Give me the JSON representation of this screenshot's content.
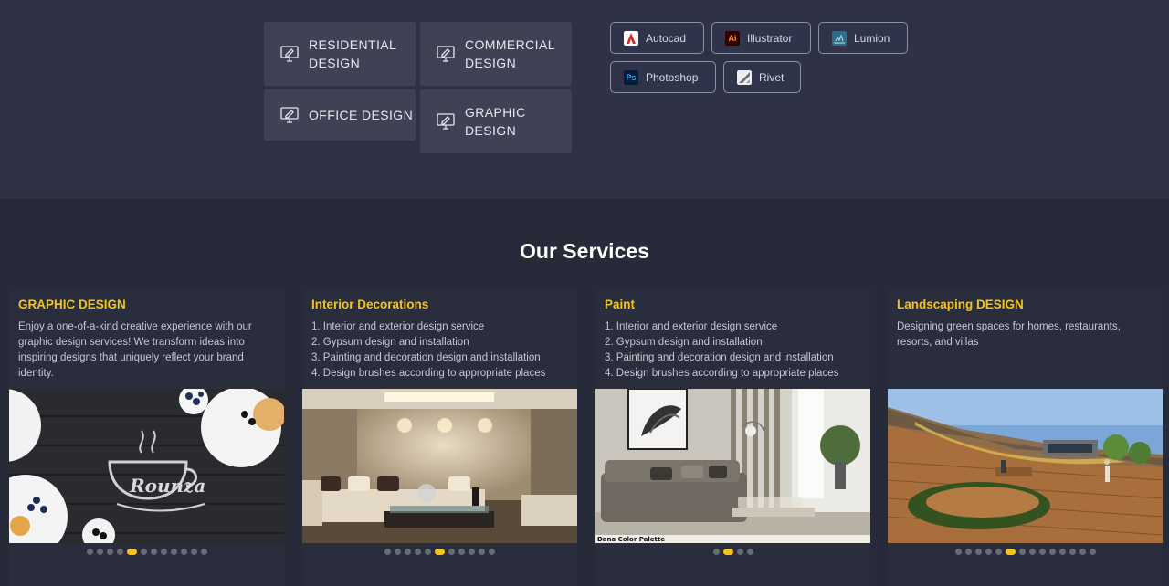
{
  "categories": [
    {
      "label": "RESIDENTIAL\nDESIGN",
      "icon": "monitor-design-icon"
    },
    {
      "label": "COMMERCIAL\nDESIGN",
      "icon": "monitor-design-icon"
    },
    {
      "label": "OFFICE DESIGN",
      "icon": "monitor-design-icon"
    },
    {
      "label": "GRAPHIC\nDESIGN",
      "icon": "monitor-design-icon"
    }
  ],
  "software": [
    {
      "name": "Autocad",
      "icon": "autocad-logo-icon",
      "color": "#d8262d"
    },
    {
      "name": "Illustrator",
      "icon": "illustrator-logo-icon",
      "badge": "Ai",
      "color": "#ff9a00"
    },
    {
      "name": "Lumion",
      "icon": "lumion-logo-icon",
      "color": "#3f97b8"
    },
    {
      "name": "Photoshop",
      "icon": "photoshop-logo-icon",
      "badge": "Ps",
      "color": "#31a8ff"
    },
    {
      "name": "Rivet",
      "icon": "rivet-logo-icon",
      "color": "#e6e6e6"
    }
  ],
  "services": {
    "heading": "Our Services",
    "cards": [
      {
        "title": "GRAPHIC DESIGN",
        "description": "Enjoy a one-of-a-kind creative experience with our\ngraphic design services! We transform ideas into\ninspiring designs that uniquely reflect your brand\nidentity.",
        "image_logo_text": "Rounza",
        "dot_count": 12,
        "active_dot": 4
      },
      {
        "title": "Interior Decorations",
        "description": "1. Interior and exterior design service\n2. Gypsum design and installation\n3. Painting and decoration design and installation\n4. Design brushes according to appropriate places",
        "dot_count": 11,
        "active_dot": 5
      },
      {
        "title": "Paint",
        "description": "1. Interior and exterior design service\n2. Gypsum design and installation\n3. Painting and decoration design and installation\n4. Design brushes according to appropriate places",
        "image_caption": "Dana Color Palette",
        "dot_count": 4,
        "active_dot": 1
      },
      {
        "title": "Landscaping DESIGN",
        "description": "Designing green spaces for homes, restaurants,\nresorts, and villas",
        "dot_count": 14,
        "active_dot": 5
      }
    ]
  },
  "colors": {
    "accent": "#f5c518",
    "top_band": "#2e3244",
    "background": "#262a39",
    "tile": "#3e4254"
  }
}
